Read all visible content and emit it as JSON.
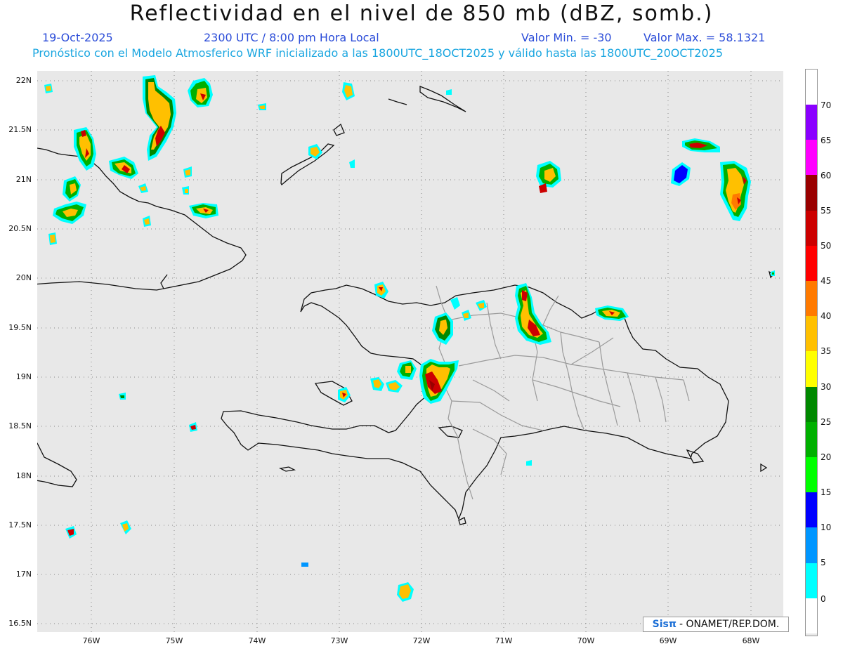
{
  "header": {
    "title": "Reflectividad en el nivel de 850 mb (dBZ, somb.)",
    "date": "19-Oct-2025",
    "time": "2300 UTC / 8:00 pm Hora Local",
    "value_min": "Valor Min. = -30",
    "value_max": "Valor Max. = 58.1321",
    "model_info": "Pronóstico con el Modelo Atmosferico WRF inicializado a las 1800UTC_18OCT2025 y válido hasta las  1800UTC_20OCT2025"
  },
  "axes": {
    "lat_labels": [
      "22N",
      "21.5N",
      "21N",
      "20.5N",
      "20N",
      "19.5N",
      "19N",
      "18.5N",
      "18N",
      "17.5N",
      "17N",
      "16.5N"
    ],
    "lon_labels": [
      "76W",
      "75W",
      "74W",
      "73W",
      "72W",
      "71W",
      "70W",
      "69W",
      "68W"
    ]
  },
  "colorbar": {
    "labels": [
      "70",
      "65",
      "60",
      "55",
      "50",
      "45",
      "40",
      "35",
      "30",
      "25",
      "20",
      "15",
      "10",
      "5",
      "0"
    ],
    "colors": [
      "#8a00ff",
      "#ff00ff",
      "#990000",
      "#cc0000",
      "#ff0000",
      "#ff7a00",
      "#ffc000",
      "#ffff00",
      "#008800",
      "#00b000",
      "#00ff00",
      "#0000ff",
      "#0096ff",
      "#00ffff",
      "#ffffff",
      "#e8e8e8"
    ]
  },
  "colors": {
    "map_background": "#e8e8e8",
    "coastline": "#111111",
    "province_border": "#9a9a9a",
    "grid": "#888888"
  },
  "credit": {
    "sis": "Sisπ",
    "rest": "- ONAMET/REP.DOM."
  }
}
